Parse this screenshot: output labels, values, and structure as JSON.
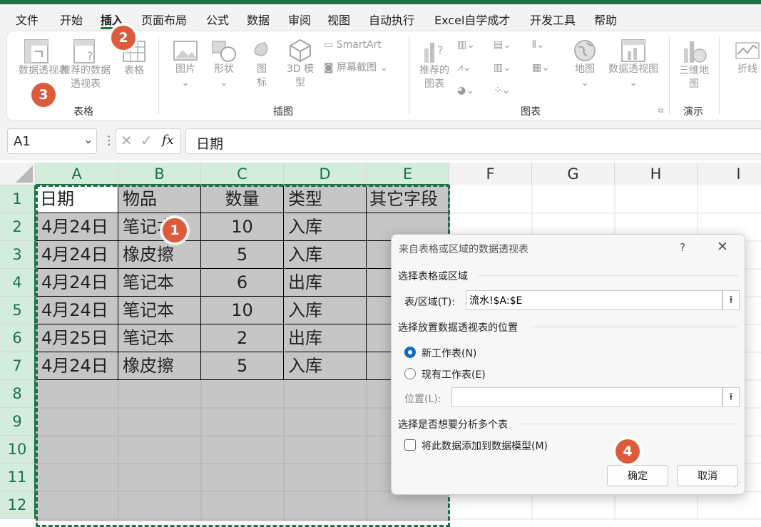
{
  "menu": {
    "items": [
      "文件",
      "开始",
      "插入",
      "页面布局",
      "公式",
      "数据",
      "审阅",
      "视图",
      "自动执行",
      "Excel自学成才",
      "开发工具",
      "帮助"
    ],
    "active": "插入"
  },
  "ribbon": {
    "tables_group": {
      "label": "表格",
      "pivot_table": "数据透视表",
      "recommended_pivot": "推荐的数据透视表",
      "table": "表格"
    },
    "illustrations_group": {
      "label": "插图",
      "pictures": "图片",
      "shapes": "形状",
      "icons": "图标",
      "models_3d": "3D 模型",
      "smartart": "SmartArt",
      "screenshot": "屏幕截图"
    },
    "charts_group": {
      "label": "图表",
      "recommended_charts": "推荐的图表",
      "map": "地图",
      "pivot_chart": "数据透视图"
    },
    "tours_group": {
      "label": "演示",
      "map_3d": "三维地图"
    },
    "sparklines": {
      "line": "折线"
    }
  },
  "formula_bar": {
    "name_box": "A1",
    "fx": "fx",
    "formula": "日期"
  },
  "columns": [
    "A",
    "B",
    "C",
    "D",
    "E",
    "F",
    "G",
    "H",
    "I"
  ],
  "rows": [
    "1",
    "2",
    "3",
    "4",
    "5",
    "6",
    "7",
    "8",
    "9",
    "10",
    "11",
    "12"
  ],
  "table": {
    "headers": [
      "日期",
      "物品",
      "数量",
      "类型",
      "其它字段"
    ],
    "rows": [
      [
        "4月24日",
        "笔记本",
        "10",
        "入库",
        ""
      ],
      [
        "4月24日",
        "橡皮擦",
        "5",
        "入库",
        ""
      ],
      [
        "4月24日",
        "笔记本",
        "6",
        "出库",
        ""
      ],
      [
        "4月24日",
        "笔记本",
        "10",
        "入库",
        ""
      ],
      [
        "4月25日",
        "笔记本",
        "2",
        "出库",
        ""
      ],
      [
        "4月24日",
        "橡皮擦",
        "5",
        "入库",
        ""
      ]
    ]
  },
  "dialog": {
    "title": "来自表格或区域的数据透视表",
    "help": "?",
    "section1": "选择表格或区域",
    "range_label": "表/区域(T):",
    "range_value": "流水!$A:$E",
    "section2": "选择放置数据透视表的位置",
    "new_sheet": "新工作表(N)",
    "existing_sheet": "现有工作表(E)",
    "location_label": "位置(L):",
    "location_value": "",
    "section3": "选择是否想要分析多个表",
    "add_model": "将此数据添加到数据模型(M)",
    "ok": "确定",
    "cancel": "取消"
  },
  "badges": [
    "1",
    "2",
    "3",
    "4"
  ],
  "colors": {
    "accent": "#1e7145",
    "badge": "#dd5a3a",
    "selection_fill": "#c6c6c6",
    "radio_on": "#0f6cbd"
  }
}
